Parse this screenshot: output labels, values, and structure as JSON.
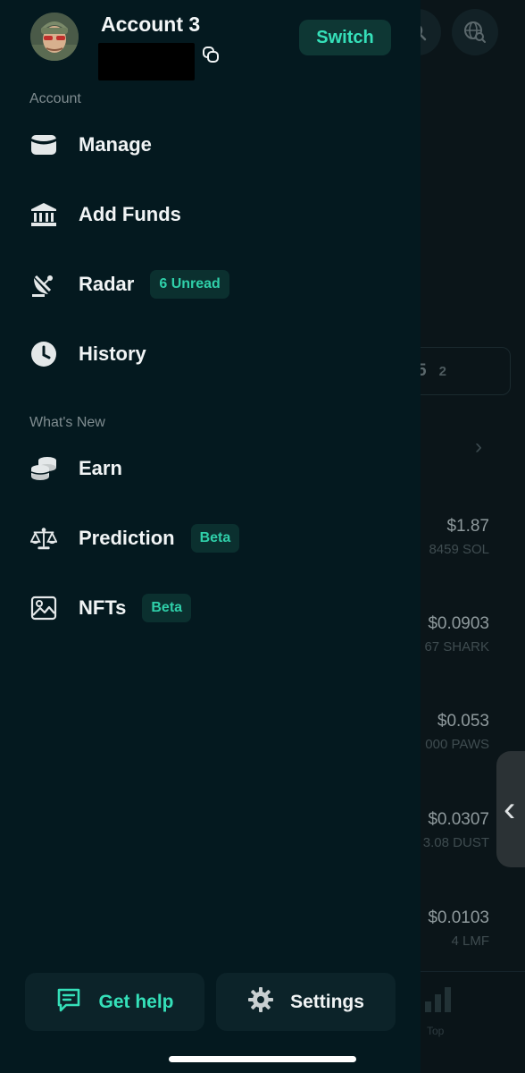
{
  "background": {
    "segment_main": "5",
    "segment_small": "2",
    "rows": [
      {
        "price": "$1.87",
        "amount": "8459 SOL"
      },
      {
        "price": "$0.0903",
        "amount": "67 SHARK"
      },
      {
        "price": "$0.053",
        "amount": "000 PAWS"
      },
      {
        "price": "$0.0307",
        "amount": "3.08 DUST"
      },
      {
        "price": "$0.0103",
        "amount": "4 LMF"
      }
    ],
    "bottom_tab_label": "Top"
  },
  "header": {
    "account_name": "Account 3",
    "switch_label": "Switch"
  },
  "sections": {
    "account_label": "Account",
    "whats_new_label": "What's New"
  },
  "menu": {
    "manage": {
      "label": "Manage",
      "icon": "wallet-icon"
    },
    "add_funds": {
      "label": "Add Funds",
      "icon": "bank-icon"
    },
    "radar": {
      "label": "Radar",
      "icon": "satellite-dish-icon",
      "badge": "6 Unread"
    },
    "history": {
      "label": "History",
      "icon": "clock-icon"
    },
    "earn": {
      "label": "Earn",
      "icon": "coins-icon"
    },
    "prediction": {
      "label": "Prediction",
      "icon": "scales-icon",
      "badge": "Beta"
    },
    "nfts": {
      "label": "NFTs",
      "icon": "image-icon",
      "badge": "Beta"
    }
  },
  "footer": {
    "help_label": "Get help",
    "settings_label": "Settings"
  },
  "colors": {
    "accent": "#35e0b9",
    "drawer_bg": "#04191f",
    "badge_bg": "#0b302f"
  }
}
